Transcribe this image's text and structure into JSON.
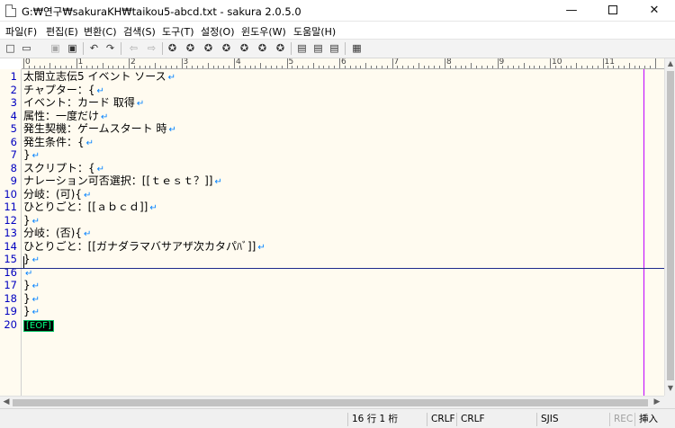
{
  "window": {
    "title": "G:₩연구₩sakuraKH₩taikou5-abcd.txt - sakura 2.0.5.0",
    "minimize_glyph": "—",
    "close_glyph": "✕"
  },
  "menu": [
    "파일(F)",
    "편집(E)",
    "변환(C)",
    "검색(S)",
    "도구(T)",
    "설정(O)",
    "윈도우(W)",
    "도움말(H)"
  ],
  "toolbar": {
    "icons": [
      "new-file-icon",
      "open-folder-icon",
      "save-icon",
      "save-as-icon",
      "undo-icon",
      "redo-icon",
      "back-icon",
      "forward-icon",
      "search-icon",
      "search-prev-icon",
      "search-next-icon",
      "search-mark-icon",
      "replace-icon",
      "grep-icon",
      "clear-mark-icon",
      "tag-jump-icon",
      "tag-back-icon",
      "macro-record-icon",
      "macro-run-icon",
      "bookmark-icon",
      "outline-icon"
    ]
  },
  "ruler": {
    "labels": [
      "0",
      "1",
      "2",
      "3",
      "4",
      "5",
      "6",
      "7",
      "8",
      "9",
      "10",
      "11"
    ]
  },
  "editor": {
    "eol_glyph": "↵",
    "eof_label": "[EOF]",
    "lines": [
      {
        "n": "1",
        "text": "太閤立志伝5 イベント ソース"
      },
      {
        "n": "2",
        "text": "チャプター：{"
      },
      {
        "n": "3",
        "text": "イベント：カード 取得"
      },
      {
        "n": "4",
        "text": "属性：一度だけ"
      },
      {
        "n": "5",
        "text": "発生契機：ゲームスタート 時"
      },
      {
        "n": "6",
        "text": "発生条件：{"
      },
      {
        "n": "7",
        "text": "}"
      },
      {
        "n": "8",
        "text": "スクリプト：{"
      },
      {
        "n": "9",
        "text": "ナレーション可否選択：[[ｔｅｓｔ？]]"
      },
      {
        "n": "10",
        "text": "分岐：(可){"
      },
      {
        "n": "11",
        "text": "ひとりごと：[[ａｂｃｄ]]"
      },
      {
        "n": "12",
        "text": "}"
      },
      {
        "n": "13",
        "text": "分岐：(否){"
      },
      {
        "n": "14",
        "text": "ひとりごと：[[ガナダラマバサアザ次カタパﾊﾞ]]"
      },
      {
        "n": "15",
        "text": "}"
      },
      {
        "n": "16",
        "text": ""
      },
      {
        "n": "17",
        "text": "}"
      },
      {
        "n": "18",
        "text": "}"
      },
      {
        "n": "19",
        "text": "}"
      },
      {
        "n": "20",
        "text": ""
      }
    ]
  },
  "statusbar": {
    "position": "16 行   1 桁",
    "eol1": "CRLF",
    "eol2": "CRLF",
    "encoding": "SJIS",
    "rec": "REC",
    "mode": "挿入"
  },
  "colors": {
    "editor_bg": "#fffbf0",
    "line_number": "#0000c0",
    "eol_mark": "#0080ff",
    "wrap_guide": "#c000ff",
    "cursor_underline": "#1e2a8c"
  }
}
